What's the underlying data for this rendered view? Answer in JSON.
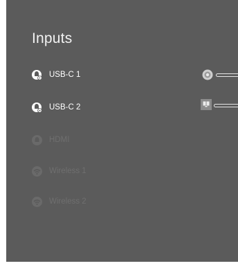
{
  "panel": {
    "title": "Inputs"
  },
  "inputs": [
    {
      "label": "USB-C 1",
      "icon": "usb-c-device-icon",
      "enabled": true,
      "connected_device": "camera-device-icon"
    },
    {
      "label": "USB-C 2",
      "icon": "usb-c-device-icon",
      "enabled": true,
      "connected_device": "laptop-device-icon"
    },
    {
      "label": "HDMI",
      "icon": "hdmi-icon",
      "enabled": false
    },
    {
      "label": "Wireless 1",
      "icon": "wireless-icon",
      "enabled": false
    },
    {
      "label": "Wireless 2",
      "icon": "wireless-icon",
      "enabled": false
    }
  ],
  "colors": {
    "panel_bg": "#5b5b5b",
    "text_active": "#ffffff",
    "text_disabled": "#6f6f6f",
    "icon_active": "#ffffff",
    "icon_disabled": "#6a6a6a"
  }
}
